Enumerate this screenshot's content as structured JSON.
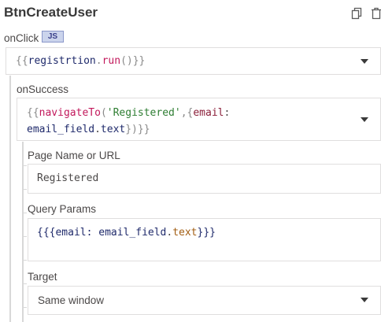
{
  "panel": {
    "title": "BtnCreateUser"
  },
  "onclick": {
    "label": "onClick",
    "badge": "JS",
    "code": {
      "open": "{{",
      "ident": "registrtion",
      "dot": ".",
      "method": "run",
      "parens": "()",
      "close": "}}"
    }
  },
  "on_success": {
    "label": "onSuccess",
    "code": {
      "open": "{{",
      "fn": "navigateTo",
      "paren_open": "(",
      "string": "'Registered'",
      "comma_brace": ",{",
      "key": "email",
      "colon": ":",
      "value_ident": "email_field",
      "value_dot": ".",
      "value_prop": "text",
      "end": "})}}"
    }
  },
  "page_name": {
    "label": "Page Name or URL",
    "value": "Registered"
  },
  "query_params": {
    "label": "Query Params",
    "open": "{{{",
    "key": "email:",
    "value_ident": "email_field",
    "value_dot": ".",
    "value_prop": "text",
    "close": "}}}"
  },
  "target": {
    "label": "Target",
    "value": "Same window"
  }
}
